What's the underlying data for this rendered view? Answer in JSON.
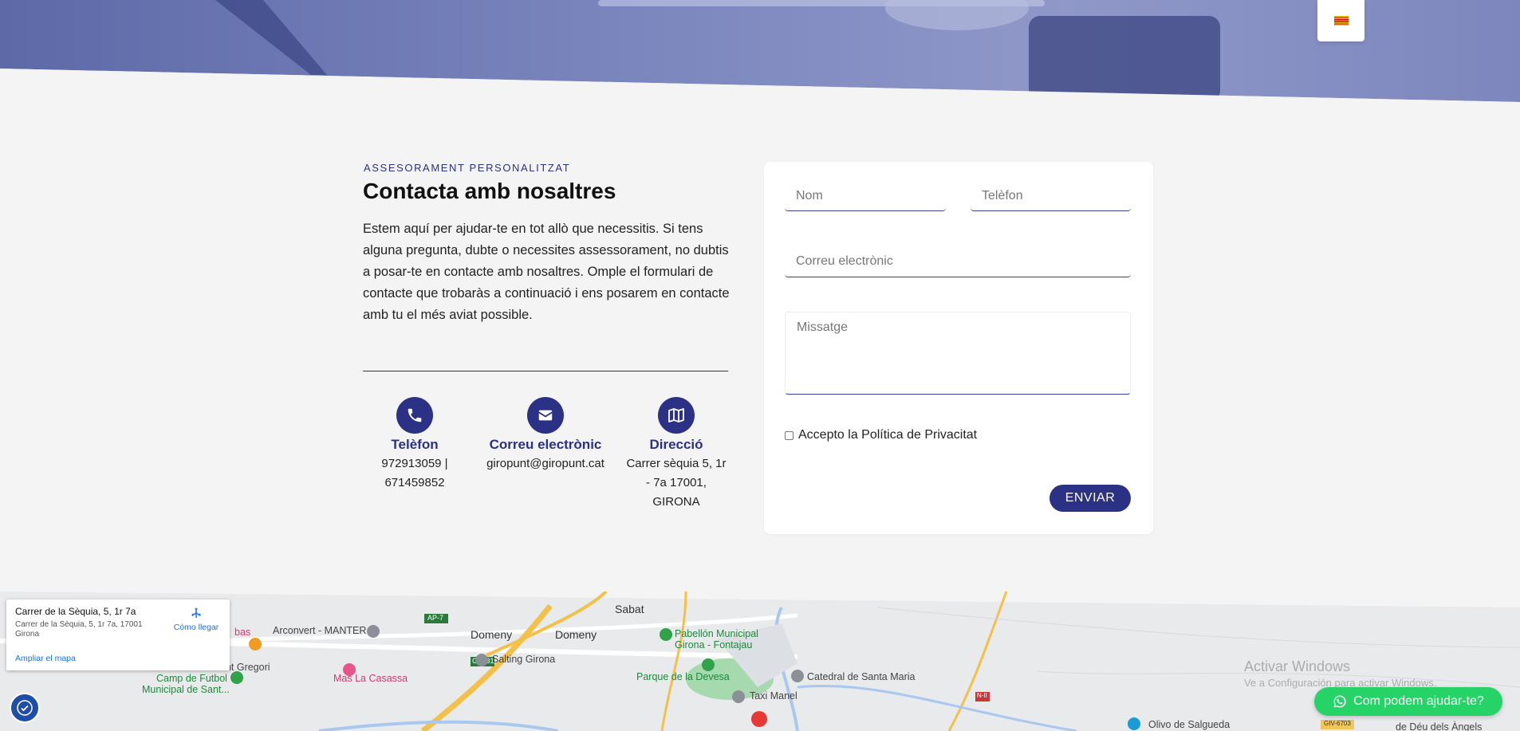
{
  "header": {
    "language_flag": "catalan-flag-icon"
  },
  "intro": {
    "eyebrow": "ASSESORAMENT PERSONALITZAT",
    "title": "Contacta amb nosaltres",
    "body": "Estem aquí per ajudar-te en tot allò que necessitis. Si tens alguna pregunta, dubte o necessites assessorament, no dubtis a posar-te en contacte amb nosaltres. Omple el formulari de contacte que trobaràs a continuació i ens posarem en contacte amb tu el més aviat possible."
  },
  "contact_info": [
    {
      "icon": "phone-icon",
      "title": "Telèfon",
      "line1": "972913059 |",
      "line2": "671459852",
      "line3": ""
    },
    {
      "icon": "envelope-icon",
      "title": "Correu electrònic",
      "line1": "giropunt@giropunt.cat",
      "line2": "",
      "line3": ""
    },
    {
      "icon": "map-icon",
      "title": "Direcció",
      "line1": "Carrer sèquia 5, 1r",
      "line2": "- 7a 17001,",
      "line3": "GIRONA"
    }
  ],
  "form": {
    "name_placeholder": "Nom",
    "phone_placeholder": "Telèfon",
    "email_placeholder": "Correu electrònic",
    "message_placeholder": "Missatge",
    "privacy_label": "Accepto la Política de Privacitat",
    "submit_label": "ENVIAR"
  },
  "map": {
    "place_name": "Carrer de la Sèquia, 5, 1r 7a",
    "place_address": "Carrer de la Sèquia, 5, 1r 7a, 17001 Girona",
    "directions_label": "Cómo llegar",
    "enlarge_label": "Ampliar el mapa",
    "labels": {
      "sabat": "Sabat",
      "arconvert": "Arconvert - MANTER",
      "domeny1": "Domeny",
      "domeny2": "Domeny",
      "pabellon1": "Pabellón Municipal",
      "pabellon2": "Girona - Fontajau",
      "gregori": "unt Gregori",
      "camp1": "Camp de Futbol",
      "camp2": "Municipal de Sant...",
      "mas": "Mas La Casassa",
      "salting": "Salting Girona",
      "parque": "Parque de la Devesa",
      "catedral": "Catedral de Santa Maria",
      "taxi": "Taxi Manel",
      "bas": "bas",
      "olivo": "Olivo de Salgueda",
      "deu": "de Déu dels Àngels",
      "ap7": "AP-7",
      "gi531": "GI-531",
      "n2": "N-II",
      "giv": "GIV-6703"
    }
  },
  "watermark": {
    "line1": "Activar Windows",
    "line2": "Ve a Configuración para activar Windows."
  },
  "whatsapp": {
    "label": "Com podem ajudar-te?"
  }
}
